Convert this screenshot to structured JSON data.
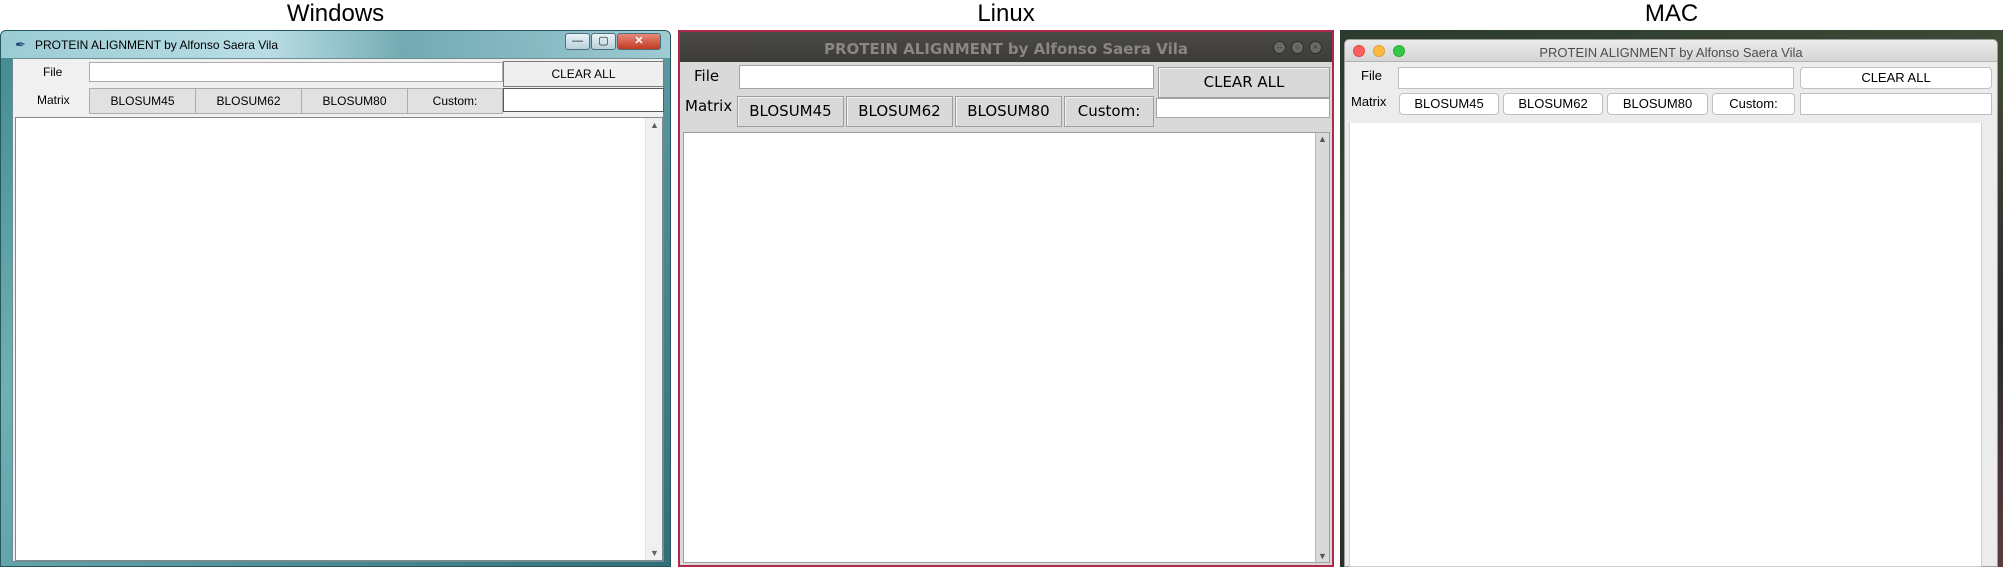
{
  "captions": {
    "windows": "Windows",
    "linux": "Linux",
    "mac": "MAC"
  },
  "app": {
    "title": "PROTEIN ALIGNMENT by Alfonso Saera Vila",
    "file_label": "File",
    "matrix_label": "Matrix",
    "file_value": "",
    "custom_value": "",
    "clear_label": "CLEAR ALL",
    "matrix_buttons": [
      "BLOSUM45",
      "BLOSUM62",
      "BLOSUM80",
      "Custom:"
    ],
    "output_text": ""
  },
  "windows_titlebar": {
    "minimize": "—",
    "maximize": "▢",
    "close": "✕"
  },
  "colors": {
    "linux_frame": "#b0284a",
    "mac_close": "#fc605c",
    "mac_minimize": "#fdbc40",
    "mac_zoom": "#34c84a"
  }
}
